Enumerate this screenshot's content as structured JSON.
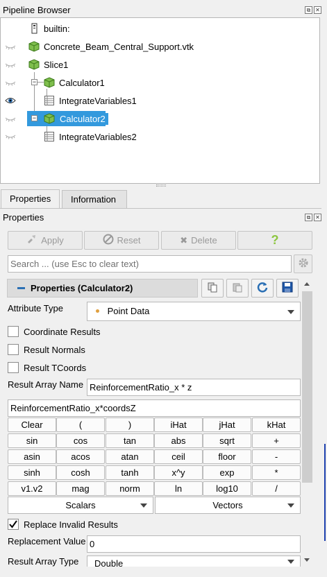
{
  "pipeline_browser": {
    "title": "Pipeline Browser",
    "items": [
      {
        "label": "builtin:",
        "icon": "server-icon",
        "eye": "none"
      },
      {
        "label": "Concrete_Beam_Central_Support.vtk",
        "icon": "dataset-cube-icon",
        "eye": "hidden"
      },
      {
        "label": "Slice1",
        "icon": "dataset-cube-icon",
        "eye": "hidden"
      },
      {
        "label": "Calculator1",
        "icon": "dataset-cube-icon",
        "eye": "hidden"
      },
      {
        "label": "IntegrateVariables1",
        "icon": "spreadsheet-icon",
        "eye": "visible"
      },
      {
        "label": "Calculator2",
        "icon": "dataset-cube-icon",
        "eye": "hidden",
        "selected": true
      },
      {
        "label": "IntegrateVariables2",
        "icon": "spreadsheet-icon",
        "eye": "hidden"
      }
    ]
  },
  "tabs": [
    {
      "label": "Properties",
      "active": true
    },
    {
      "label": "Information",
      "active": false
    }
  ],
  "properties": {
    "title": "Properties",
    "buttons": {
      "apply": "Apply",
      "reset": "Reset",
      "delete": "Delete",
      "help": "?"
    },
    "search_placeholder": "Search ... (use Esc to clear text)",
    "section_title": "Properties (Calculator2)",
    "attribute_type_label": "Attribute Type",
    "attribute_type_value": "Point Data",
    "coordinate_results": "Coordinate Results",
    "result_normals": "Result Normals",
    "result_tcoords": "Result TCoords",
    "result_array_name_label": "Result Array Name",
    "result_array_name_value": "ReinforcementRatio_x * z",
    "expression": "ReinforcementRatio_x*coordsZ",
    "calc_rows": [
      [
        "Clear",
        "(",
        ")",
        "iHat",
        "jHat",
        "kHat"
      ],
      [
        "sin",
        "cos",
        "tan",
        "abs",
        "sqrt",
        "+"
      ],
      [
        "asin",
        "acos",
        "atan",
        "ceil",
        "floor",
        "-"
      ],
      [
        "sinh",
        "cosh",
        "tanh",
        "x^y",
        "exp",
        "*"
      ],
      [
        "v1.v2",
        "mag",
        "norm",
        "ln",
        "log10",
        "/"
      ]
    ],
    "scalars_label": "Scalars",
    "vectors_label": "Vectors",
    "replace_invalid_label": "Replace Invalid Results",
    "replacement_value_label": "Replacement Value",
    "replacement_value": "0",
    "result_array_type_label": "Result Array Type",
    "result_array_type_value": "Double"
  },
  "colors": {
    "selection": "#3399dd",
    "accent_blue": "#2a6fb4",
    "help_green": "#8cc63f"
  }
}
